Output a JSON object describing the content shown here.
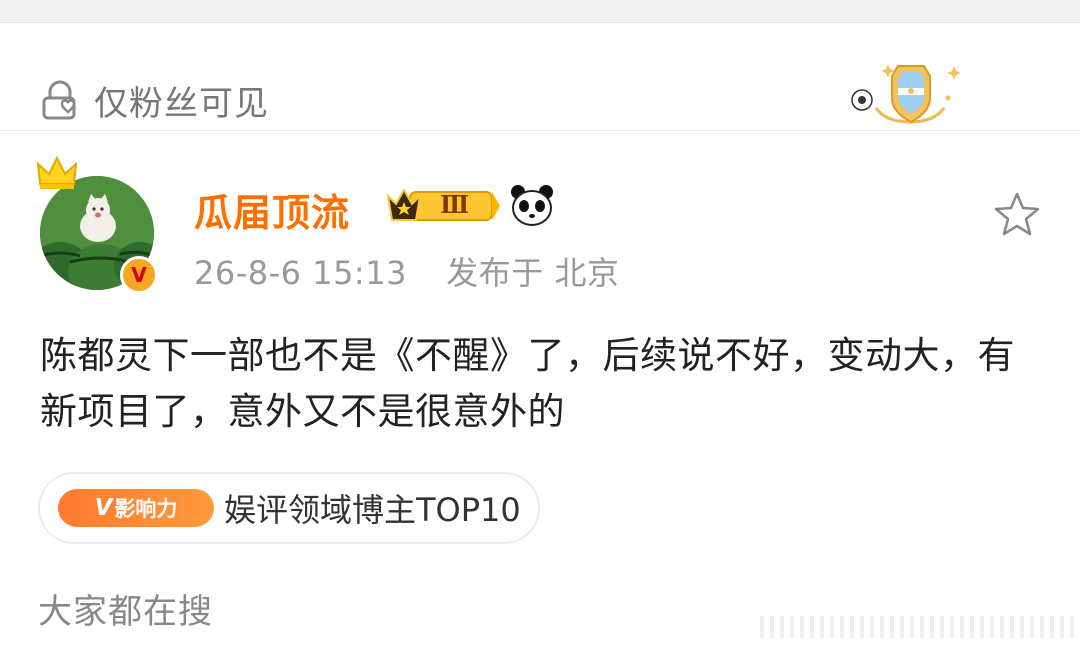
{
  "visibility": {
    "label": "仅粉丝可见",
    "icon": "lock-heart-icon"
  },
  "header": {
    "emblem": "football-argentina-shield-badge-icon"
  },
  "user": {
    "name": "瓜届顶流",
    "level_badge": "Ⅲ",
    "timestamp": "26-8-6 15:13",
    "source": "发布于 北京",
    "verified": "V",
    "avatar": "watermelon-cat-avatar"
  },
  "post": {
    "text": "陈都灵下一部也不是《不醒》了，后续说不好，变动大，有新项目了，意外又不是很意外的"
  },
  "influence": {
    "badge_mark": "V",
    "badge_label": "影响力",
    "title": "娱评领域博主TOP10"
  },
  "section": {
    "title": "大家都在搜"
  },
  "colors": {
    "username": "#ff6f00",
    "accent_orange": "#ff8a2a",
    "meta_gray": "#999999",
    "verified_gold": "#f5a623"
  }
}
